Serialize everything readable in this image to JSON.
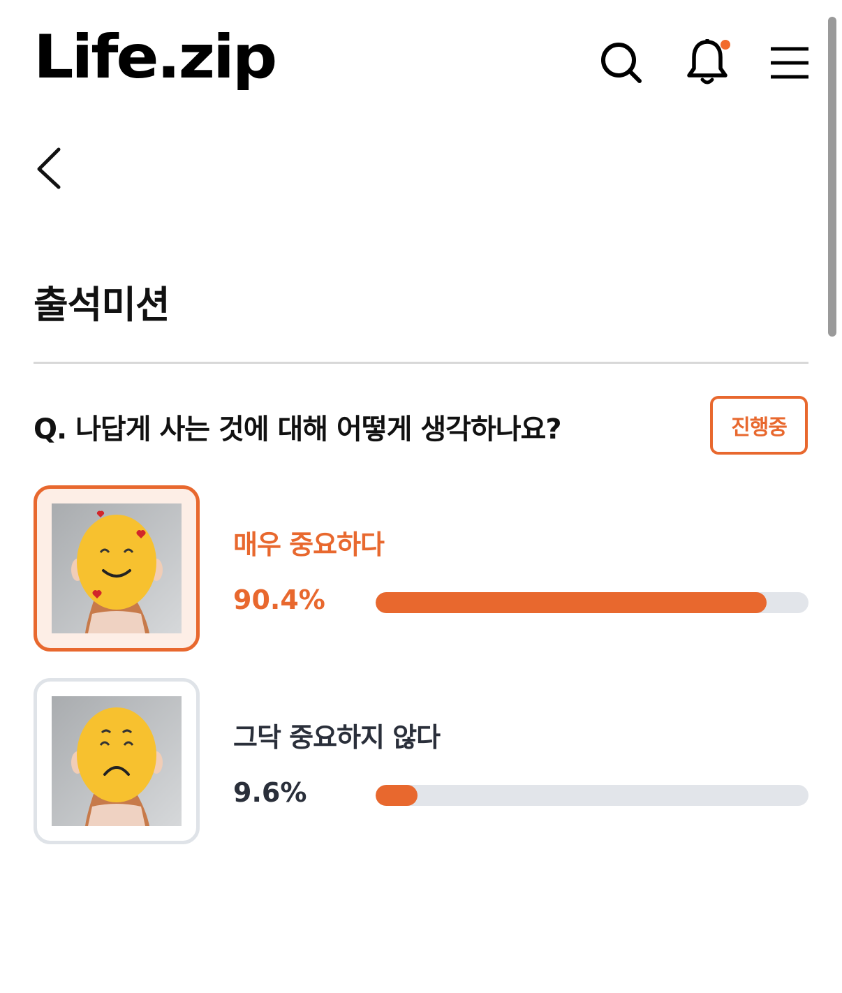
{
  "header": {
    "logo_text": "Life.zip",
    "icons": {
      "search": "search-icon",
      "notifications": "bell-icon",
      "menu": "hamburger-menu-icon",
      "notification_dot_color": "#f26b2d"
    }
  },
  "nav": {
    "back_icon": "chevron-left-icon"
  },
  "page": {
    "title": "출석미션"
  },
  "poll": {
    "question": "Q. 나답게 사는 것에 대해 어떻게 생각하나요?",
    "status": "진행중",
    "accent_color": "#e8682e",
    "options": [
      {
        "label": "매우 중요하다",
        "percent_text": "90.4%",
        "fraction": 0.904,
        "selected": true,
        "image_icon": "happy-emoji-face-photo"
      },
      {
        "label": "그닥 중요하지 않다",
        "percent_text": "9.6%",
        "fraction": 0.096,
        "selected": false,
        "image_icon": "sad-emoji-face-photo"
      }
    ]
  }
}
